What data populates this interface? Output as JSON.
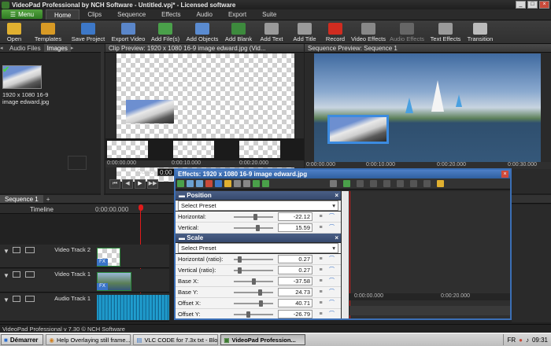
{
  "window": {
    "title": "VideoPad Professional by NCH Software - Untitled.vpj* - Licensed software",
    "min": "_",
    "max": "□",
    "close": "×"
  },
  "menu": {
    "button_label": "Menu",
    "tabs": [
      "Home",
      "Clips",
      "Sequence",
      "Effects",
      "Audio",
      "Export",
      "Suite"
    ],
    "active_tab": "Home"
  },
  "toolbar": {
    "items": [
      {
        "label": "Open",
        "icon": "folder-icon",
        "color": "#e0b030"
      },
      {
        "label": "Templates",
        "icon": "templates-icon",
        "color": "#d89a25"
      },
      {
        "label": "Save Project",
        "icon": "save-icon",
        "color": "#3d78c8"
      },
      {
        "label": "Export Video",
        "icon": "export-video-icon",
        "color": "#5a86c9"
      },
      {
        "label": "Add File(s)",
        "icon": "add-files-icon",
        "color": "#4aa04a"
      },
      {
        "label": "Add Objects",
        "icon": "add-objects-icon",
        "color": "#5a8bd0"
      },
      {
        "label": "Add Blank",
        "icon": "add-blank-icon",
        "color": "#3d8a3d"
      },
      {
        "label": "Add Text",
        "icon": "add-text-icon",
        "color": "#9a9a9a"
      },
      {
        "label": "Add Title",
        "icon": "add-title-icon",
        "color": "#9a9a9a"
      },
      {
        "label": "Record",
        "icon": "record-icon",
        "color": "#d02c20"
      },
      {
        "label": "Video Effects",
        "icon": "video-effects-icon",
        "color": "#888888"
      },
      {
        "label": "Audio Effects",
        "icon": "audio-effects-icon",
        "color": "#666666",
        "disabled": true
      },
      {
        "label": "Text Effects",
        "icon": "text-effects-icon",
        "color": "#9a9a9a"
      },
      {
        "label": "Transition",
        "icon": "transition-icon",
        "color": "#bbbbbb"
      }
    ]
  },
  "media": {
    "tabs": [
      "Audio Files",
      "Images"
    ],
    "active_tab": "Images",
    "item_caption": "1920 x 1080 16-9 image edward.jpg"
  },
  "clip_preview": {
    "title": "Clip Preview: 1920 x 1080 16-9 image edward.jpg (Vid...",
    "ruler": [
      "0:00:00.000",
      "0:00:10.000",
      "0:00:20.000",
      "0:00:30.000"
    ],
    "cursor_label": "Cursor:",
    "cursor_value": "0:00"
  },
  "sequence_preview": {
    "title": "Sequence Preview: Sequence 1",
    "ruler": [
      "0:00:00.000",
      "0:00:10.000",
      "0:00:20.000",
      "0:00:30.000"
    ]
  },
  "sequence": {
    "tab": "Sequence 1",
    "add": "+",
    "timeline_label": "Timeline",
    "timecode": "0:00:00.000",
    "tracks": [
      "Video Track 2",
      "Video Track 1",
      "Audio Track 1"
    ],
    "fx": "FX"
  },
  "effects": {
    "title": "Effects: 1920 x 1080 16-9 image edward.jpg",
    "sections": [
      {
        "name": "Position",
        "preset": "Select Preset",
        "rows": [
          {
            "label": "Horizontal:",
            "value": "-22.12",
            "level": 0.55
          },
          {
            "label": "Vertical:",
            "value": "15.59",
            "level": 0.62
          }
        ]
      },
      {
        "name": "Scale",
        "preset": "Select Preset",
        "rows": [
          {
            "label": "Horizontal (ratio):",
            "value": "0.27",
            "level": 0.12
          },
          {
            "label": "Vertical (ratio):",
            "value": "0.27",
            "level": 0.12
          },
          {
            "label": "Base X:",
            "value": "-37.58",
            "level": 0.5
          },
          {
            "label": "Base Y:",
            "value": "24.73",
            "level": 0.68
          },
          {
            "label": "Offset X:",
            "value": "40.71",
            "level": 0.72
          },
          {
            "label": "Offset Y:",
            "value": "-26.79",
            "level": 0.35
          }
        ]
      }
    ],
    "kf_ruler": [
      "0:00:00.000",
      "0:00:20.000"
    ]
  },
  "status": "VideoPad Professional v 7.30 © NCH Software",
  "taskbar": {
    "start": "Démarrer",
    "tasks": [
      "Help Overlaying still frame...",
      "VLC CODE for 7.3x txt - Blo...",
      "VideoPad Profession..."
    ],
    "active": 2,
    "lang": "FR",
    "time": "09:31"
  }
}
